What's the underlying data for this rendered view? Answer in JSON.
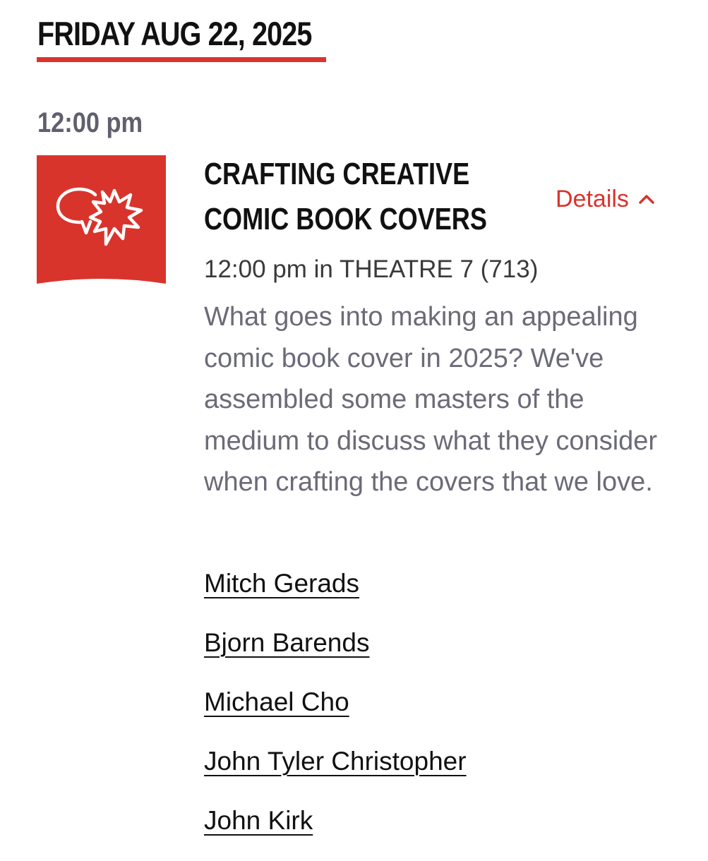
{
  "schedule": {
    "date_heading": "FRIDAY AUG 22, 2025",
    "time_heading": "12:00 pm",
    "accent_color": "#d8342c"
  },
  "event": {
    "icon": "comic-speech-bubbles-icon",
    "title": "CRAFTING CREATIVE COMIC BOOK COVERS",
    "details_label": "Details",
    "details_state": "expanded",
    "location": "12:00 pm in THEATRE 7 (713)",
    "description": "What goes into making an appealing comic book cover in 2025? We've assembled some masters of the medium to discuss what they consider when crafting the covers that we love.",
    "panelists": [
      "Mitch Gerads",
      "Bjorn Barends",
      "Michael Cho",
      "John Tyler Christopher",
      "John Kirk"
    ]
  }
}
